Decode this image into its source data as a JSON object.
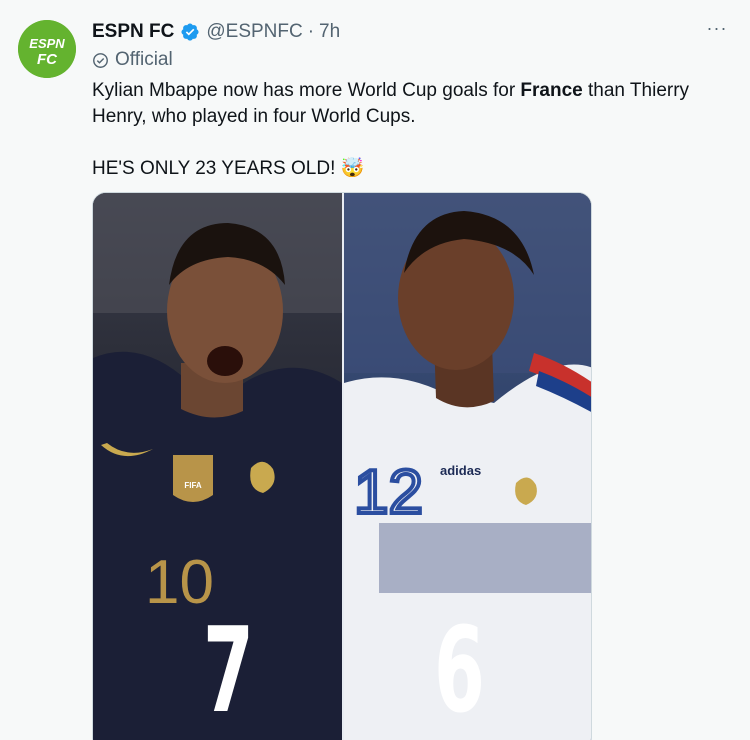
{
  "tweet": {
    "author_name": "ESPN FC",
    "handle": "@ESPNFC",
    "separator": "·",
    "time": "7h",
    "label": "Official",
    "more": "···",
    "text_line1_before": "Kylian Mbappe now has more World Cup goals for ",
    "text_line1_bold": "France",
    "text_line1_after": " than Thierry",
    "text_line2": "Henry, who played in four World Cups.",
    "text_line3": "HE'S ONLY 23 YEARS OLD! 🤯",
    "avatar_text_top": "ESPN",
    "avatar_text_bottom": "FC"
  },
  "media": {
    "left_stat": "7",
    "right_stat": "6",
    "left_jersey_number": "10",
    "right_jersey_number": "12",
    "jersey_brand": "adidas",
    "badge_text": "FIFA"
  },
  "colors": {
    "avatar_bg": "#64b32f",
    "verified": "#1d9bf0",
    "secondary_text": "#536471",
    "primary_text": "#0f1419"
  }
}
